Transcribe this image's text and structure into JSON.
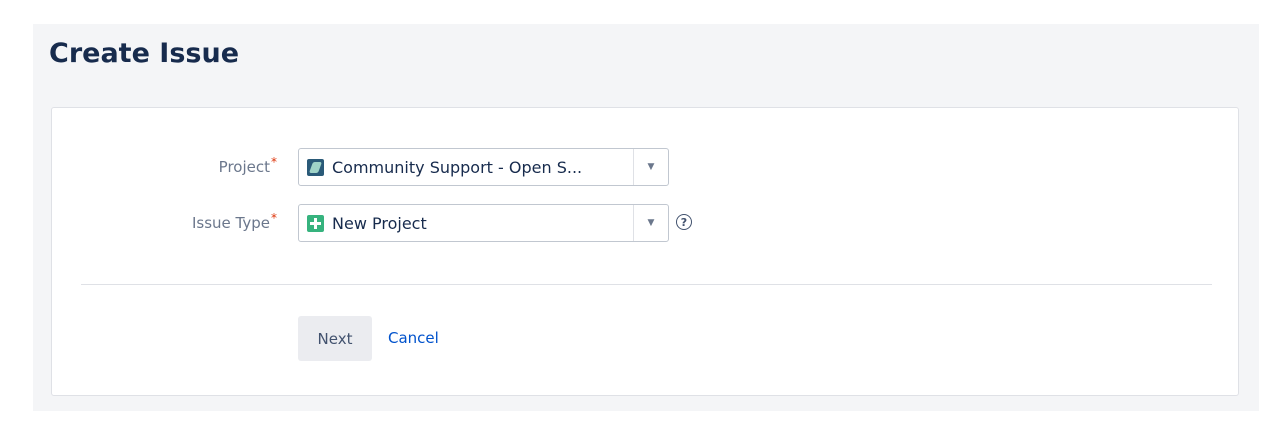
{
  "dialog": {
    "title": "Create Issue"
  },
  "form": {
    "project": {
      "label": "Project",
      "required_mark": "*",
      "value": "Community Support - Open S...",
      "icon": "project-avatar-icon"
    },
    "issue_type": {
      "label": "Issue Type",
      "required_mark": "*",
      "value": "New Project",
      "icon": "plus-square-icon"
    },
    "dropdown_arrow": "▼",
    "help_glyph": "?"
  },
  "actions": {
    "next_label": "Next",
    "cancel_label": "Cancel"
  },
  "colors": {
    "accent": "#0052cc",
    "required": "#de350b",
    "issue_type_icon": "#36b37e"
  }
}
